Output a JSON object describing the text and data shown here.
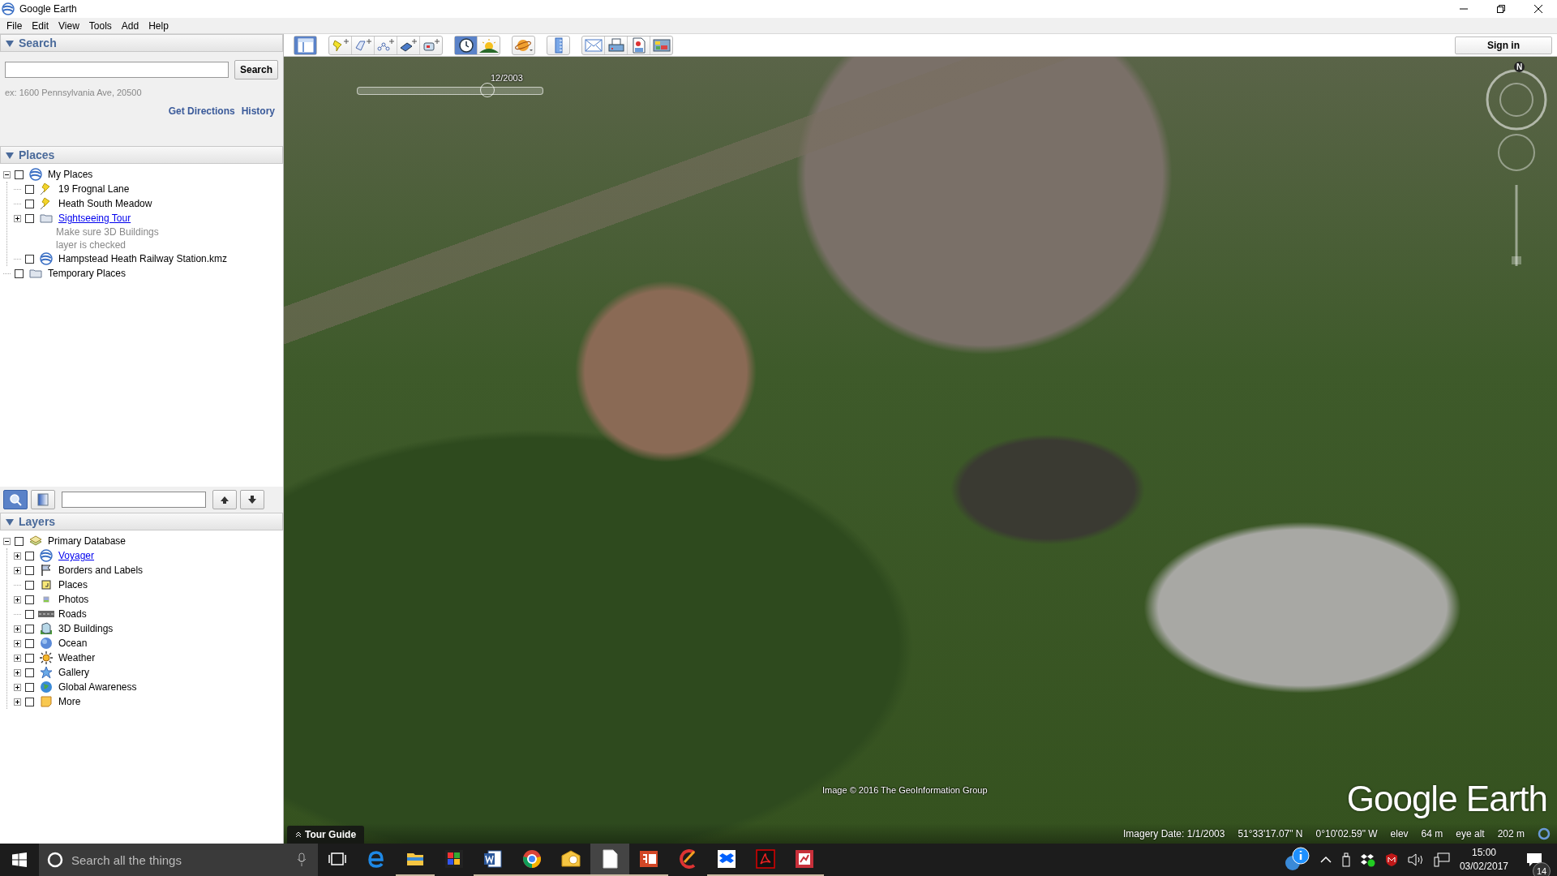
{
  "window": {
    "title": "Google Earth"
  },
  "menu": [
    "File",
    "Edit",
    "View",
    "Tools",
    "Add",
    "Help"
  ],
  "search": {
    "header": "Search",
    "expanded": true,
    "button": "Search",
    "hint": "ex: 1600 Pennsylvania Ave, 20500",
    "links": [
      "Get Directions",
      "History"
    ]
  },
  "places": {
    "header": "Places",
    "expanded": true,
    "items": [
      {
        "label": "My Places",
        "kind": "globe",
        "checked": false,
        "expanded": true,
        "children": [
          {
            "label": "19 Frognal Lane",
            "kind": "pin",
            "checked": false
          },
          {
            "label": "Heath South Meadow",
            "kind": "pin",
            "checked": false
          },
          {
            "label": "Sightseeing Tour",
            "kind": "folder",
            "checked": false,
            "expanded": false,
            "link": true,
            "description": "Make sure 3D Buildings layer is checked"
          },
          {
            "label": "Hampstead Heath Railway Station.kmz",
            "kind": "globe",
            "checked": false
          }
        ]
      },
      {
        "label": "Temporary Places",
        "kind": "folder",
        "checked": false
      }
    ]
  },
  "places_toolbar": {
    "modes": [
      {
        "selected": true
      },
      {
        "selected": false
      }
    ]
  },
  "layers": {
    "header": "Layers",
    "expanded": true,
    "items": [
      {
        "label": "Primary Database",
        "kind": "layers",
        "checked": false,
        "expanded": true,
        "children": [
          {
            "label": "Voyager",
            "kind": "globe",
            "checked": false,
            "expanded": false,
            "link": true
          },
          {
            "label": "Borders and Labels",
            "kind": "flag",
            "checked": false,
            "expanded": false
          },
          {
            "label": "Places",
            "kind": "square",
            "checked": false
          },
          {
            "label": "Photos",
            "kind": "photo",
            "checked": false,
            "expanded": false
          },
          {
            "label": "Roads",
            "kind": "road",
            "checked": false
          },
          {
            "label": "3D Buildings",
            "kind": "building",
            "checked": false,
            "expanded": false
          },
          {
            "label": "Ocean",
            "kind": "ocean",
            "checked": false,
            "expanded": false
          },
          {
            "label": "Weather",
            "kind": "sun",
            "checked": false,
            "expanded": false
          },
          {
            "label": "Gallery",
            "kind": "star",
            "checked": false,
            "expanded": false
          },
          {
            "label": "Global Awareness",
            "kind": "earth",
            "checked": false,
            "expanded": false
          },
          {
            "label": "More",
            "kind": "note",
            "checked": false,
            "expanded": false
          }
        ]
      }
    ]
  },
  "toolbar": [
    [
      {
        "kind": "sidebar",
        "selected": true
      }
    ],
    [
      {
        "kind": "pinadd",
        "selected": false
      },
      {
        "kind": "polygonadd",
        "selected": false
      },
      {
        "kind": "pathadd",
        "selected": false
      },
      {
        "kind": "overlayadd",
        "selected": false
      },
      {
        "kind": "recordadd",
        "selected": false
      }
    ],
    [
      {
        "kind": "clock",
        "selected": true
      },
      {
        "kind": "sunrise",
        "selected": false
      }
    ],
    [
      {
        "kind": "planet",
        "selected": false
      }
    ],
    [
      {
        "kind": "ruler",
        "selected": false
      }
    ],
    [
      {
        "kind": "envelope",
        "selected": false
      },
      {
        "kind": "printer",
        "selected": false
      },
      {
        "kind": "mappin",
        "selected": false
      },
      {
        "kind": "picture",
        "selected": false
      }
    ]
  ],
  "sign_in": "Sign in",
  "map": {
    "time_slider": {
      "label": "12/2003",
      "level": 0.7
    },
    "compass_label": "N",
    "attribution": "Image © 2016 The GeoInformation Group",
    "logo": "Google Earth",
    "tour_guide": "Tour Guide",
    "status": {
      "imagery_date": "Imagery Date: 1/1/2003",
      "latitude": "51°33'17.07\" N",
      "longitude": "0°10'02.59\" W",
      "elev_label": "elev",
      "elev": "64 m",
      "eye_alt_label": "eye alt",
      "eye_alt": "202 m"
    }
  },
  "taskbar": {
    "search_placeholder": "Search all the things",
    "apps": [
      {
        "kind": "e",
        "running": false,
        "selected": false
      },
      {
        "kind": "folder",
        "running": true,
        "selected": false
      },
      {
        "kind": "puzzle",
        "running": false,
        "selected": false
      },
      {
        "kind": "word",
        "running": true,
        "selected": false
      },
      {
        "kind": "chrome",
        "running": true,
        "selected": false
      },
      {
        "kind": "mail",
        "running": true,
        "selected": false
      },
      {
        "kind": "page",
        "running": true,
        "selected": true
      },
      {
        "kind": "slides",
        "running": true,
        "selected": false
      },
      {
        "kind": "brush",
        "running": false,
        "selected": false
      },
      {
        "kind": "box",
        "running": true,
        "selected": false
      },
      {
        "kind": "pdf",
        "running": true,
        "selected": false
      },
      {
        "kind": "chart",
        "running": true,
        "selected": false
      }
    ],
    "time": "15:00",
    "date": "03/02/2017",
    "notifications": "14"
  }
}
